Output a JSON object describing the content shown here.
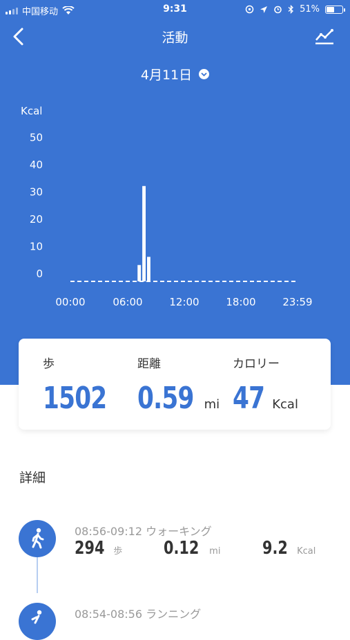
{
  "status_bar": {
    "carrier": "中国移动",
    "time": "9:31",
    "battery": "51%",
    "battery_level": 0.51
  },
  "header": {
    "title": "活動",
    "date": "4月11日",
    "back_icon": "chevron-left-icon",
    "trend_icon": "line-chart-icon"
  },
  "chart_data": {
    "type": "bar",
    "ylabel": "Kcal",
    "yticks": [
      "50",
      "40",
      "30",
      "20",
      "10",
      "0"
    ],
    "ylim": [
      0,
      50
    ],
    "xticks": [
      "00:00",
      "06:00",
      "12:00",
      "18:00",
      "23:59"
    ],
    "values": [
      0,
      0,
      0,
      0,
      0,
      0,
      0,
      0,
      0,
      0,
      0,
      0,
      0,
      0,
      6,
      35,
      9,
      0,
      0,
      0,
      0,
      0,
      0,
      0,
      0,
      0,
      0,
      0,
      0,
      0,
      0,
      0,
      0,
      0,
      0,
      0,
      0,
      0,
      0,
      0,
      0,
      0,
      0,
      0,
      0,
      0,
      0,
      0
    ],
    "colors": {
      "bar": "#ffffff"
    }
  },
  "summary": {
    "steps": {
      "label": "歩",
      "value": "1502"
    },
    "distance": {
      "label": "距離",
      "value": "0.59",
      "unit": "mi"
    },
    "calories": {
      "label": "カロリー",
      "value": "47",
      "unit": "Kcal"
    }
  },
  "detail_title": "詳細",
  "activities": [
    {
      "time": "08:56-09:12 ウォーキング",
      "steps": "294",
      "steps_unit": "歩",
      "distance": "0.12",
      "distance_unit": "mi",
      "calories": "9.2",
      "calories_unit": "Kcal",
      "icon": "walking-icon"
    },
    {
      "time": "08:54-08:56 ランニング",
      "icon": "running-icon"
    }
  ],
  "colors": {
    "primary": "#3a74d3",
    "text": "#333333",
    "muted": "#999999"
  }
}
